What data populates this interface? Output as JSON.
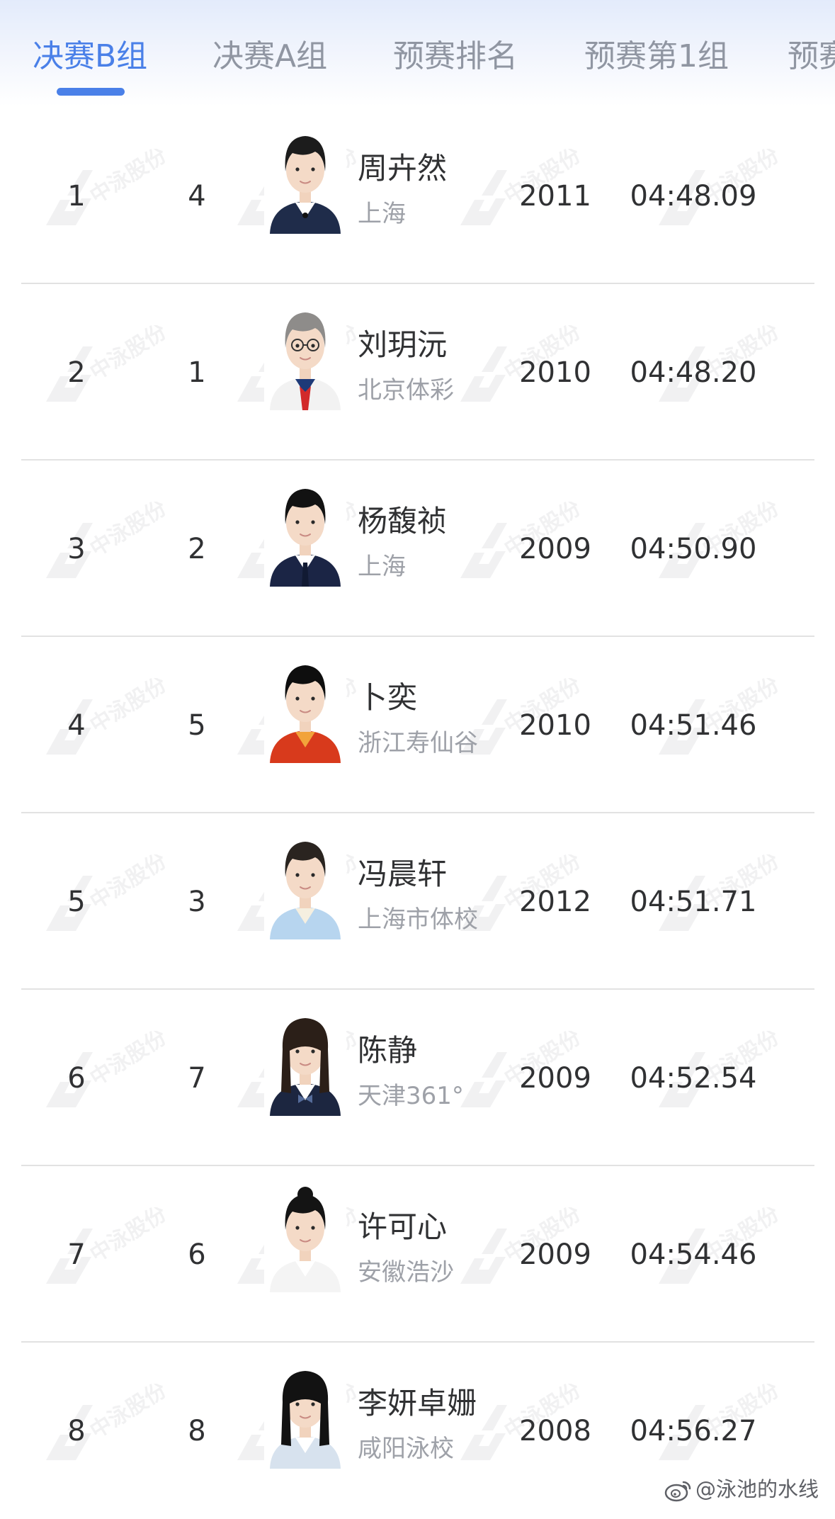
{
  "tabs": [
    {
      "label": "决赛B组",
      "active": true
    },
    {
      "label": "决赛A组",
      "active": false
    },
    {
      "label": "预赛排名",
      "active": false
    },
    {
      "label": "预赛第1组",
      "active": false
    },
    {
      "label": "预赛",
      "active": false
    }
  ],
  "results": [
    {
      "rank": "1",
      "lane": "4",
      "name": "周卉然",
      "team": "上海",
      "year": "2011",
      "time": "04:48.09"
    },
    {
      "rank": "2",
      "lane": "1",
      "name": "刘玥沅",
      "team": "北京体彩",
      "year": "2010",
      "time": "04:48.20"
    },
    {
      "rank": "3",
      "lane": "2",
      "name": "杨馥祯",
      "team": "上海",
      "year": "2009",
      "time": "04:50.90"
    },
    {
      "rank": "4",
      "lane": "5",
      "name": "卜奕",
      "team": "浙江寿仙谷",
      "year": "2010",
      "time": "04:51.46"
    },
    {
      "rank": "5",
      "lane": "3",
      "name": "冯晨轩",
      "team": "上海市体校",
      "year": "2012",
      "time": "04:51.71"
    },
    {
      "rank": "6",
      "lane": "7",
      "name": "陈静",
      "team": "天津361°",
      "year": "2009",
      "time": "04:52.54"
    },
    {
      "rank": "7",
      "lane": "6",
      "name": "许可心",
      "team": "安徽浩沙",
      "year": "2009",
      "time": "04:54.46"
    },
    {
      "rank": "8",
      "lane": "8",
      "name": "李妍卓姗",
      "team": "咸阳泳校",
      "year": "2008",
      "time": "04:56.27"
    }
  ],
  "watermark": {
    "text": "中泳股份"
  },
  "footer": {
    "weibo_handle": "@泳池的水线"
  },
  "colors": {
    "accent": "#4a80e8",
    "text": "#303133",
    "muted": "#9ea1a8",
    "tab_inactive": "#9096a2"
  }
}
